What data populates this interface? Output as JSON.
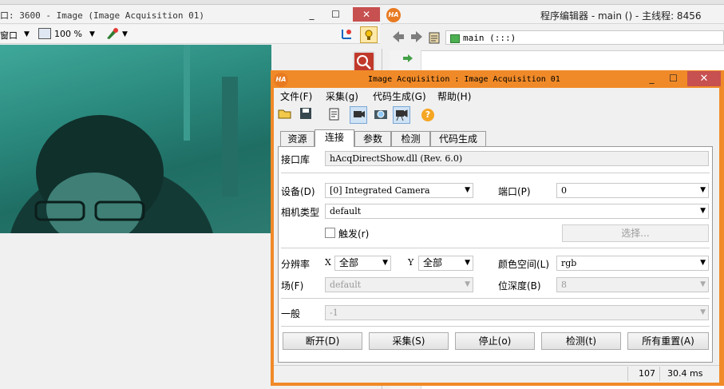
{
  "graphics_window": {
    "title": "口: 3600 - Image (Image Acquisition 01)",
    "toolbar_label": "窗口",
    "zoom_value": "100 %"
  },
  "program_editor": {
    "title": "程序编辑器 - main () - 主线程: 8456",
    "procedure": "main (:::)"
  },
  "dialog": {
    "title": "Image Acquisition : Image Acquisition 01",
    "menu": [
      "文件(F)",
      "采集(g)",
      "代码生成(G)",
      "帮助(H)"
    ],
    "tabs": [
      "资源",
      "连接",
      "参数",
      "检测",
      "代码生成"
    ],
    "active_tab": "连接",
    "interface_label": "接口库",
    "interface_value": "hAcqDirectShow.dll (Rev. 6.0)",
    "device_label": "设备(D)",
    "device_value": "[0] Integrated Camera",
    "port_label": "端口(P)",
    "port_value": "0",
    "camera_type_label": "相机类型",
    "camera_type_value": "default",
    "trigger_label": "触发(r)",
    "select_button": "选择...",
    "resolution_label": "分辨率",
    "x_label": "X",
    "x_value": "全部",
    "y_label": "Y",
    "y_value": "全部",
    "color_space_label": "颜色空间(L)",
    "color_space_value": "rgb",
    "field_label": "场(F)",
    "field_value": "default",
    "bit_depth_label": "位深度(B)",
    "bit_depth_value": "8",
    "general_label": "一般",
    "general_value": "-1",
    "buttons": [
      "断开(D)",
      "采集(S)",
      "停止(o)",
      "检测(t)",
      "所有重置(A)"
    ],
    "status": {
      "count": "107",
      "time": "30.4 ms"
    }
  },
  "colors": {
    "dialog_border": "#f08a28",
    "close_red": "#c75050",
    "camera_teal": "#2b8a7e"
  }
}
